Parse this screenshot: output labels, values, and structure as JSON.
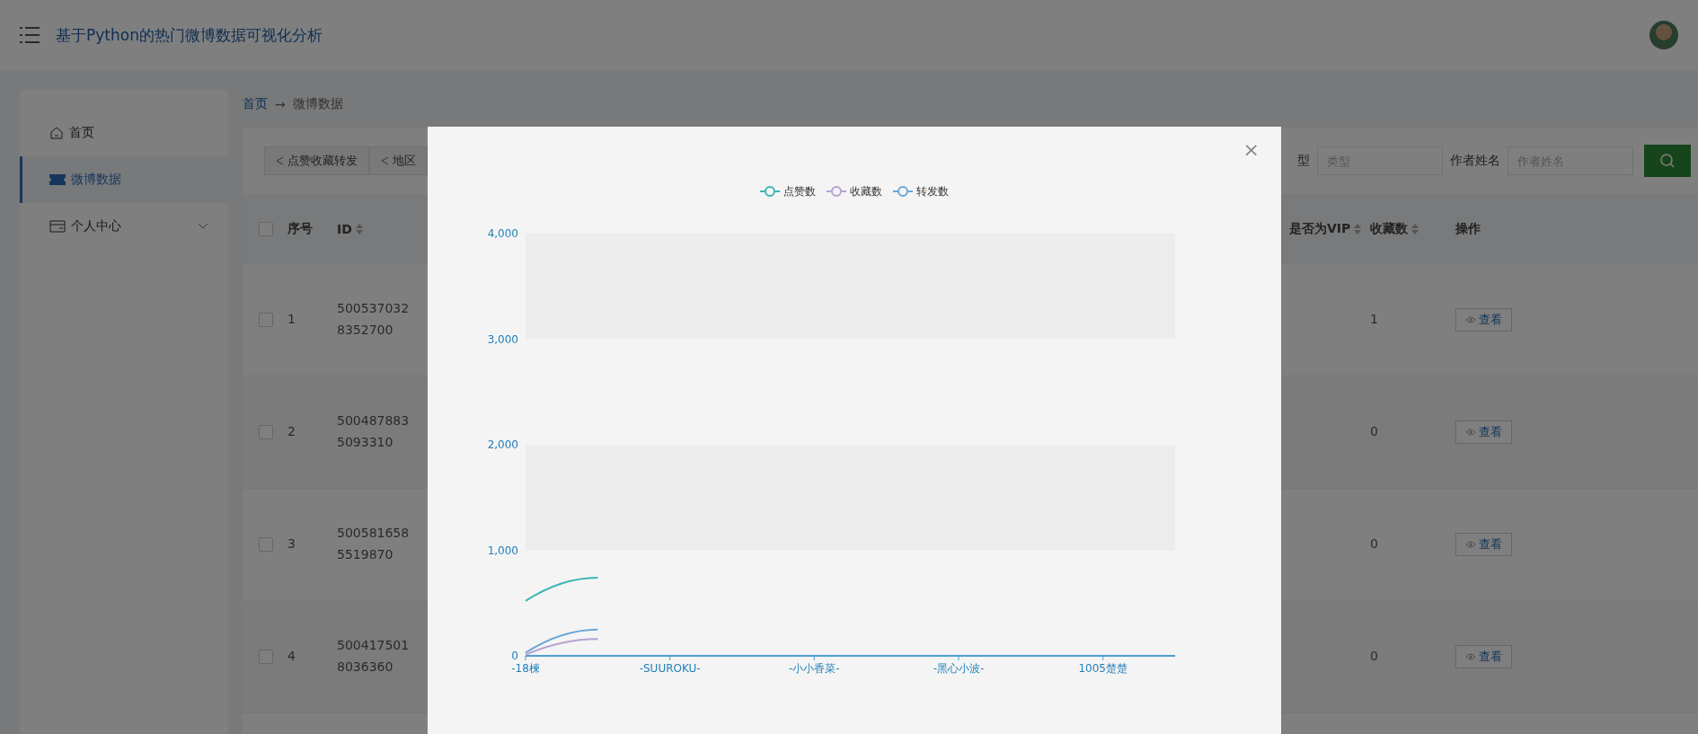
{
  "header": {
    "title": "基于Python的热门微博数据可视化分析"
  },
  "sidebar": {
    "items": [
      {
        "label": "首页",
        "kind": "home",
        "selected": false
      },
      {
        "label": "微博数据",
        "kind": "ticket",
        "selected": true
      },
      {
        "label": "个人中心",
        "kind": "wallet",
        "selected": false,
        "expandable": true
      }
    ]
  },
  "breadcrumb": {
    "home": "首页",
    "separator": "→",
    "current": "微博数据"
  },
  "toolbar": {
    "buttons": [
      "点赞收藏转发",
      "地区"
    ],
    "filters": [
      {
        "label": "型",
        "placeholder": "类型"
      },
      {
        "label": "作者姓名",
        "placeholder": "作者姓名"
      }
    ]
  },
  "table": {
    "header_checked": false,
    "columns": [
      {
        "label": "序号",
        "sortable": false
      },
      {
        "label": "ID",
        "sortable": true
      },
      {
        "label": "是否为VIP",
        "sortable": true
      },
      {
        "label": "收藏数",
        "sortable": true
      },
      {
        "label": "操作",
        "sortable": false
      }
    ],
    "rows": [
      {
        "checked": false,
        "index": "1",
        "id": "500537032\n8352700",
        "favorites": "1",
        "action": "查看"
      },
      {
        "checked": false,
        "index": "2",
        "id": "500487883\n5093310",
        "favorites": "0",
        "action": "查看"
      },
      {
        "checked": false,
        "index": "3",
        "id": "500581658\n5519870",
        "favorites": "0",
        "action": "查看"
      },
      {
        "checked": false,
        "index": "4",
        "id": "500417501\n8036360",
        "favorites": "0",
        "action": "查看"
      }
    ]
  },
  "modal": {
    "close": "×",
    "chart_data": {
      "type": "line",
      "categories": [
        "-18楝",
        null,
        "-SUUROKU-",
        null,
        "-小小香菜-",
        null,
        "-黑心小波-",
        null,
        "1005楚楚",
        null
      ],
      "ylim": [
        0,
        4000
      ],
      "yticks": [
        {
          "value": 0,
          "label": "0"
        },
        {
          "value": 1000,
          "label": "1,000"
        },
        {
          "value": 2000,
          "label": "2,000"
        },
        {
          "value": 3000,
          "label": "3,000"
        },
        {
          "value": 4000,
          "label": "4,000"
        }
      ],
      "series": [
        {
          "name": "点赞数",
          "color": "#3cb4b4",
          "values": [
            520,
            740,
            null,
            null,
            null,
            null,
            null,
            null,
            null,
            null
          ]
        },
        {
          "name": "收藏数",
          "color": "#b6a2d2",
          "values": [
            10,
            160,
            null,
            null,
            null,
            null,
            null,
            null,
            null,
            null
          ]
        },
        {
          "name": "转发数",
          "color": "#6ba5d8",
          "values": [
            30,
            250,
            null,
            null,
            null,
            null,
            null,
            null,
            null,
            null
          ]
        }
      ]
    }
  }
}
